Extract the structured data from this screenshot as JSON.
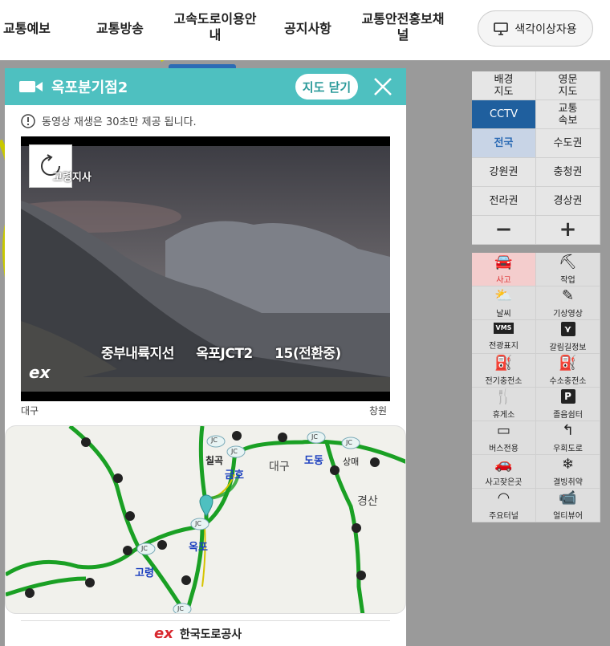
{
  "nav": {
    "items": [
      "교통예보",
      "교통방송",
      "고속도로이용안내",
      "공지사항",
      "교통안전홍보채널"
    ],
    "colorblind_label": "색각이상자용"
  },
  "popup": {
    "title": "옥포분기점2",
    "close_map_label": "지도 닫기",
    "notice": "동영상 재생은 30초만 제공 됩니다.",
    "camera_overlay_top": "고령지사",
    "camera_caption": "중부내륙지선 옥포JCT2 15(전환중)",
    "camera_logo": "ex",
    "direction_left": "대구",
    "direction_right": "창원",
    "footer_logo": "ex",
    "footer_org": "한국도로공사"
  },
  "minimap": {
    "labels": [
      {
        "text": "칠곡",
        "color": "#222"
      },
      {
        "text": "금호",
        "color": "#1b3fbf"
      },
      {
        "text": "대구",
        "color": "#444"
      },
      {
        "text": "도동",
        "color": "#1b3fbf"
      },
      {
        "text": "상매",
        "color": "#222"
      },
      {
        "text": "경산",
        "color": "#444"
      },
      {
        "text": "옥포",
        "color": "#1b3fbf"
      },
      {
        "text": "고령",
        "color": "#1b3fbf"
      }
    ],
    "jc_label": "JC"
  },
  "layers": {
    "row1": [
      "배경\n지도",
      "영문\n지도"
    ],
    "row2": [
      "CCTV",
      "교통\n속보"
    ],
    "regions": [
      "전국",
      "수도권",
      "강원권",
      "충청권",
      "전라권",
      "경상권"
    ],
    "zoom_out": "−",
    "zoom_in": "+"
  },
  "icons": [
    {
      "label": "사고",
      "icon": "accident-icon"
    },
    {
      "label": "작업",
      "icon": "work-icon"
    },
    {
      "label": "날씨",
      "icon": "weather-icon"
    },
    {
      "label": "기상영상",
      "icon": "weather-video-icon"
    },
    {
      "label": "전광표지",
      "icon": "vms-icon"
    },
    {
      "label": "갈림길정보",
      "icon": "junction-icon"
    },
    {
      "label": "전기충전소",
      "icon": "ev-charger-icon"
    },
    {
      "label": "수소충전소",
      "icon": "hydrogen-icon"
    },
    {
      "label": "휴게소",
      "icon": "rest-area-icon"
    },
    {
      "label": "졸음쉼터",
      "icon": "parking-icon"
    },
    {
      "label": "버스전용",
      "icon": "bus-icon"
    },
    {
      "label": "우회도로",
      "icon": "detour-icon"
    },
    {
      "label": "사고잦은곳",
      "icon": "accident-prone-icon"
    },
    {
      "label": "결빙취약",
      "icon": "ice-icon"
    },
    {
      "label": "주요터널",
      "icon": "tunnel-icon"
    },
    {
      "label": "얼티뷰어",
      "icon": "cctv-viewer-icon"
    }
  ],
  "accent_colors": {
    "header": "#4ec0c0",
    "active_layer": "#1f5f9e",
    "road_green": "#1aa024"
  }
}
